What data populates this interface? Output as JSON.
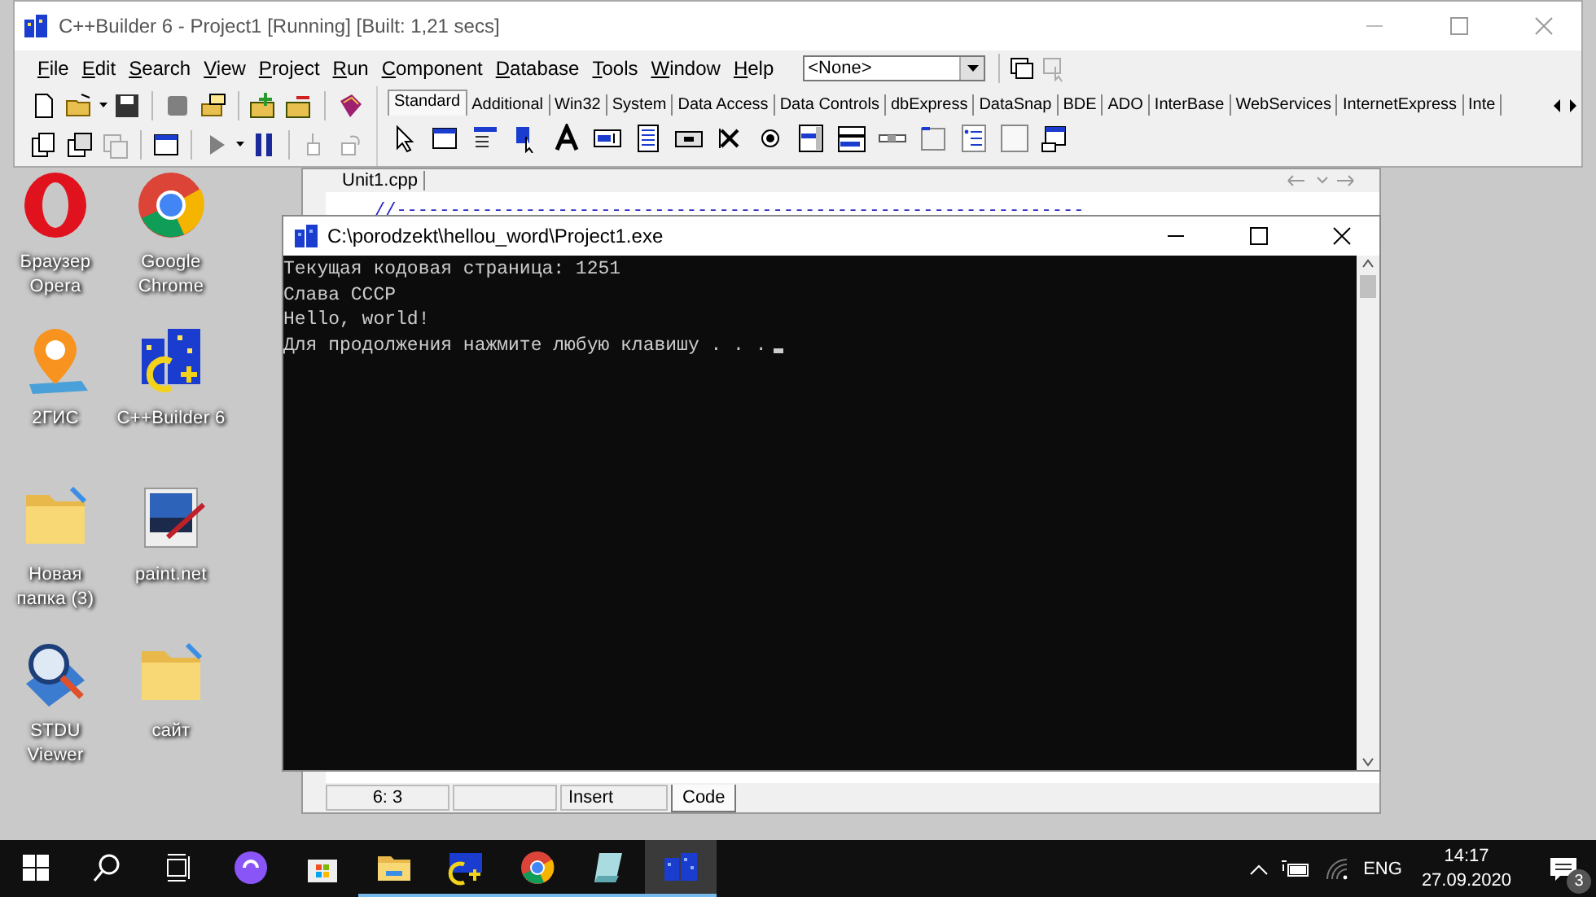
{
  "ide_window": {
    "title": "C++Builder 6 - Project1 [Running] [Built: 1,21 secs]",
    "menu": [
      "File",
      "Edit",
      "Search",
      "View",
      "Project",
      "Run",
      "Component",
      "Database",
      "Tools",
      "Window",
      "Help"
    ],
    "config_dropdown": {
      "value": "<None>"
    },
    "palette_tabs": [
      {
        "label": "Standard",
        "selected": true
      },
      {
        "label": "Additional",
        "selected": false
      },
      {
        "label": "Win32",
        "selected": false
      },
      {
        "label": "System",
        "selected": false
      },
      {
        "label": "Data Access",
        "selected": false
      },
      {
        "label": "Data Controls",
        "selected": false
      },
      {
        "label": "dbExpress",
        "selected": false
      },
      {
        "label": "DataSnap",
        "selected": false
      },
      {
        "label": "BDE",
        "selected": false
      },
      {
        "label": "ADO",
        "selected": false
      },
      {
        "label": "InterBase",
        "selected": false
      },
      {
        "label": "WebServices",
        "selected": false
      },
      {
        "label": "InternetExpress",
        "selected": false
      },
      {
        "label": "Inte",
        "selected": false
      }
    ],
    "editor": {
      "tab": "Unit1.cpp",
      "code_line": "//----------------------------------------------------------------"
    },
    "status_bar": {
      "position": "6:  3",
      "mode": "Insert",
      "view_tab": "Code"
    }
  },
  "console_window": {
    "title": "C:\\porodzekt\\hellou_word\\Project1.exe",
    "lines": [
      "Текущая кодовая страница: 1251",
      "Слава СССР",
      "Hello, world!",
      "Для продолжения нажмите любую клавишу . . ."
    ]
  },
  "desktop_icons": [
    {
      "label": "Браузер Opera",
      "kind": "opera"
    },
    {
      "label": "Google Chrome",
      "kind": "chrome"
    },
    {
      "label": "2ГИС",
      "kind": "map"
    },
    {
      "label": "C++Builder 6",
      "kind": "builder"
    },
    {
      "label": "Новая папка (3)",
      "kind": "folder"
    },
    {
      "label": "paint.net",
      "kind": "paint"
    },
    {
      "label": "STDU Viewer",
      "kind": "viewer"
    },
    {
      "label": "сайт",
      "kind": "folder"
    }
  ],
  "taskbar": {
    "apps": [
      {
        "kind": "store",
        "running": false,
        "selected": false
      },
      {
        "kind": "explorer",
        "running": true,
        "selected": false
      },
      {
        "kind": "builder",
        "running": true,
        "selected": false
      },
      {
        "kind": "chrome",
        "running": true,
        "selected": false
      },
      {
        "kind": "notepad",
        "running": true,
        "selected": false
      },
      {
        "kind": "buildings",
        "running": true,
        "selected": true
      }
    ],
    "language": "ENG",
    "time": "14:17",
    "date": "27.09.2020",
    "notifications": "3"
  }
}
